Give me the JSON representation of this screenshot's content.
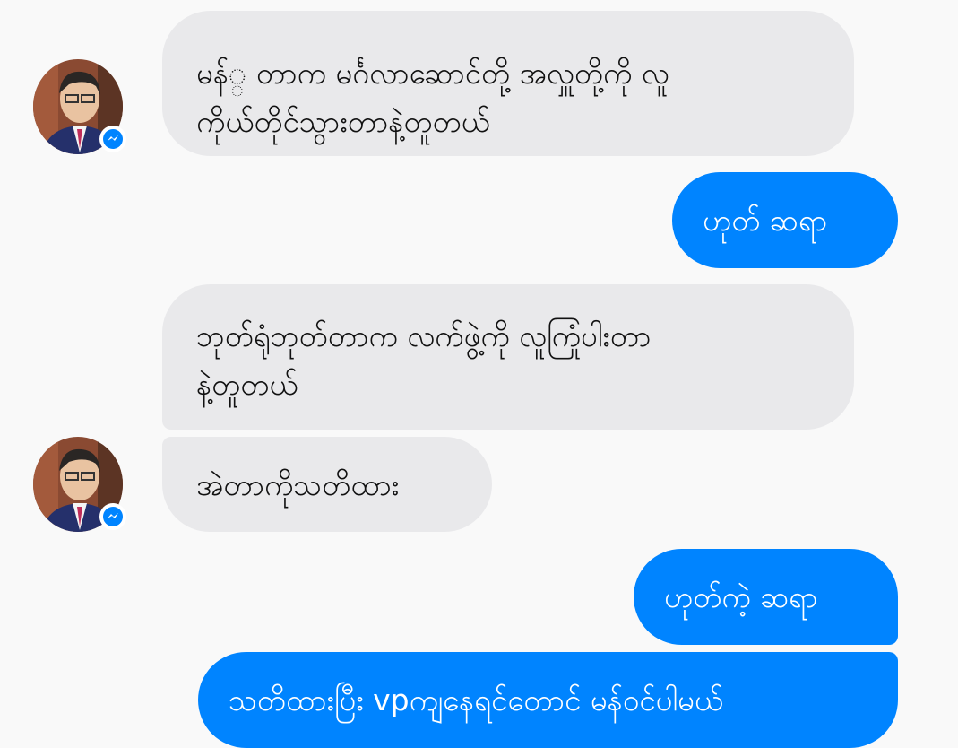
{
  "accent_color": "#0084ff",
  "incoming_bubble_color": "#e9e9eb",
  "avatar": {
    "icon": "user-avatar-icon",
    "badge_icon": "messenger-badge-icon"
  },
  "messages": [
    {
      "direction": "incoming",
      "lines": [
        "မန်္ တာက မင်္ဂလာဆောင်တို့ အလှူတို့ကို လူ",
        "ကိုယ်တိုင်သွားတာနဲ့တူတယ်"
      ]
    },
    {
      "direction": "outgoing",
      "lines": [
        "ဟုတ် ဆရာ"
      ]
    },
    {
      "direction": "incoming",
      "lines": [
        "ဘုတ်ရုံဘုတ်တာက လက်ဖွဲ့ကို လူကြုံပါးတာ",
        "နဲ့တူတယ်"
      ]
    },
    {
      "direction": "incoming",
      "lines": [
        "အဲတာကိုသတိထား"
      ]
    },
    {
      "direction": "outgoing",
      "lines": [
        "ဟုတ်ကဲ့ ဆရာ"
      ]
    },
    {
      "direction": "outgoing",
      "lines": [
        "သတိထားပြီး vpကျနေရင်တောင် မန်ဝင်ပါမယ်"
      ]
    }
  ]
}
